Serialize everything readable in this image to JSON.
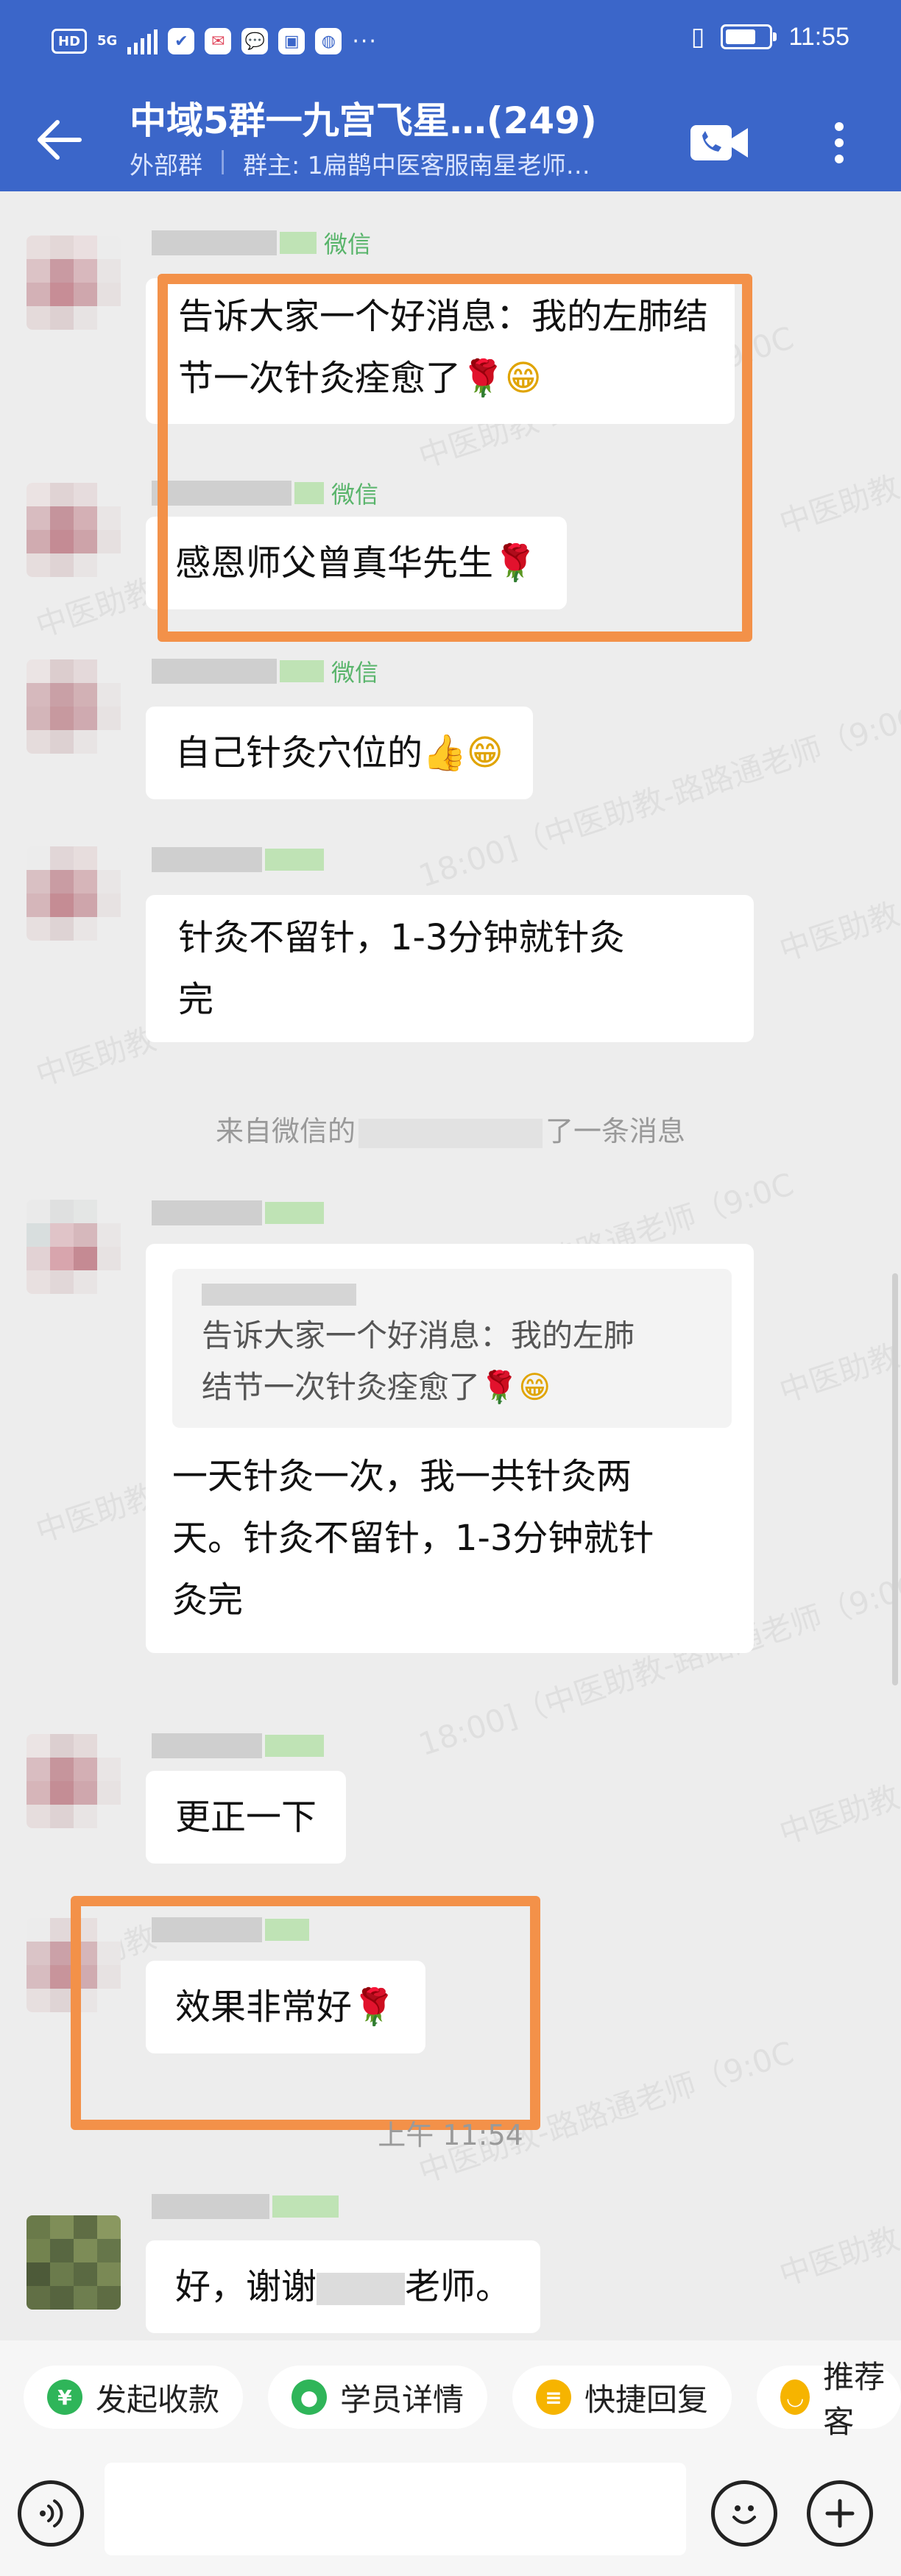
{
  "status_bar": {
    "hd": "HD",
    "network": "5G",
    "time": "11:55",
    "more": "···"
  },
  "header": {
    "title": "中域5群一九宫飞星…(249)",
    "group_type": "外部群",
    "owner": "群主: 1扁鹊中医客服南星老师…"
  },
  "messages": [
    {
      "sender_tag": "微信",
      "text": "告诉大家一个好消息：我的左肺结节一次针灸痊愈了"
    },
    {
      "sender_tag": "微信",
      "text": "感恩师父曾真华先生"
    },
    {
      "sender_tag": "微信",
      "text": "自己针灸穴位的"
    },
    {
      "sender_tag": "",
      "text_line1": "针灸不留针，1-3分钟就针灸",
      "text_line2": "完"
    },
    {
      "system_prefix": "来自微信的",
      "system_suffix": "了一条消息"
    },
    {
      "quote_line1": "告诉大家一个好消息：我的左肺",
      "quote_line2": "结节一次针灸痊愈了",
      "line1": "一天针灸一次，我一共针灸两",
      "line2": "天。针灸不留针，1-3分钟就针",
      "line3": "灸完"
    },
    {
      "text": "更正一下"
    },
    {
      "text": "效果非常好"
    },
    {
      "time": "上午 11:54"
    },
    {
      "prefix": "好，谢谢",
      "suffix": "老师。"
    }
  ],
  "emoji": {
    "rose": "🌹",
    "grin": "😁",
    "thumb": "👍"
  },
  "watermark": {
    "text1": "中医助教-路路通老师（9:0C",
    "text2": "18:00]（中医助教-路路通老师（9:0C",
    "text3": "中医助教"
  },
  "quick_actions": [
    {
      "label": "发起收款",
      "icon": "yen-icon",
      "color": "#2fb559",
      "glyph": "¥"
    },
    {
      "label": "学员详情",
      "icon": "person-icon",
      "color": "#2fb559",
      "glyph": "人"
    },
    {
      "label": "快捷回复",
      "icon": "reply-icon",
      "color": "#f6b400",
      "glyph": "="
    },
    {
      "label": "推荐客",
      "icon": "recommend-icon",
      "color": "#f6b400",
      "glyph": "◡"
    }
  ],
  "colors": {
    "header_bg": "#3b66c9",
    "chat_bg": "#ededed",
    "highlight": "#f39149",
    "wechat_green": "#58b46a"
  }
}
